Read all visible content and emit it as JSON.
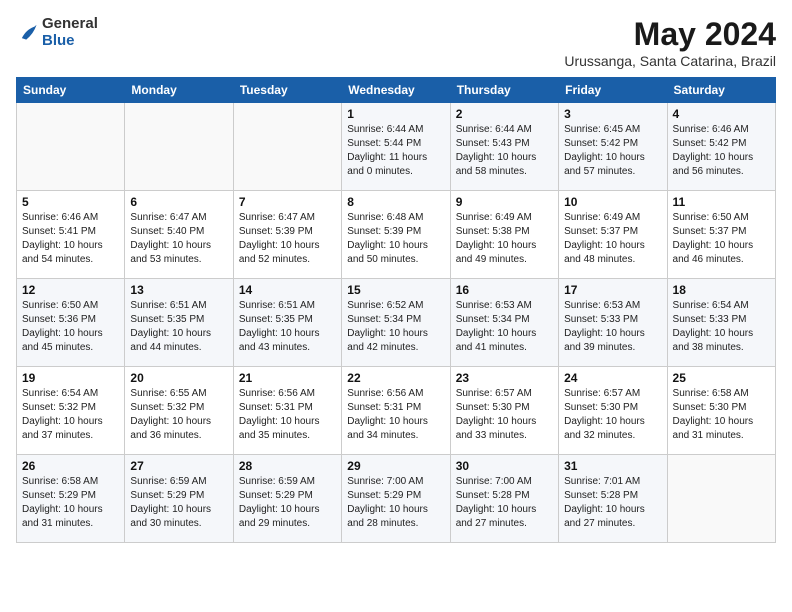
{
  "header": {
    "logo": {
      "general": "General",
      "blue": "Blue"
    },
    "title": "May 2024",
    "location": "Urussanga, Santa Catarina, Brazil"
  },
  "weekdays": [
    "Sunday",
    "Monday",
    "Tuesday",
    "Wednesday",
    "Thursday",
    "Friday",
    "Saturday"
  ],
  "weeks": [
    [
      {
        "day": "",
        "info": ""
      },
      {
        "day": "",
        "info": ""
      },
      {
        "day": "",
        "info": ""
      },
      {
        "day": "1",
        "info": "Sunrise: 6:44 AM\nSunset: 5:44 PM\nDaylight: 11 hours\nand 0 minutes."
      },
      {
        "day": "2",
        "info": "Sunrise: 6:44 AM\nSunset: 5:43 PM\nDaylight: 10 hours\nand 58 minutes."
      },
      {
        "day": "3",
        "info": "Sunrise: 6:45 AM\nSunset: 5:42 PM\nDaylight: 10 hours\nand 57 minutes."
      },
      {
        "day": "4",
        "info": "Sunrise: 6:46 AM\nSunset: 5:42 PM\nDaylight: 10 hours\nand 56 minutes."
      }
    ],
    [
      {
        "day": "5",
        "info": "Sunrise: 6:46 AM\nSunset: 5:41 PM\nDaylight: 10 hours\nand 54 minutes."
      },
      {
        "day": "6",
        "info": "Sunrise: 6:47 AM\nSunset: 5:40 PM\nDaylight: 10 hours\nand 53 minutes."
      },
      {
        "day": "7",
        "info": "Sunrise: 6:47 AM\nSunset: 5:39 PM\nDaylight: 10 hours\nand 52 minutes."
      },
      {
        "day": "8",
        "info": "Sunrise: 6:48 AM\nSunset: 5:39 PM\nDaylight: 10 hours\nand 50 minutes."
      },
      {
        "day": "9",
        "info": "Sunrise: 6:49 AM\nSunset: 5:38 PM\nDaylight: 10 hours\nand 49 minutes."
      },
      {
        "day": "10",
        "info": "Sunrise: 6:49 AM\nSunset: 5:37 PM\nDaylight: 10 hours\nand 48 minutes."
      },
      {
        "day": "11",
        "info": "Sunrise: 6:50 AM\nSunset: 5:37 PM\nDaylight: 10 hours\nand 46 minutes."
      }
    ],
    [
      {
        "day": "12",
        "info": "Sunrise: 6:50 AM\nSunset: 5:36 PM\nDaylight: 10 hours\nand 45 minutes."
      },
      {
        "day": "13",
        "info": "Sunrise: 6:51 AM\nSunset: 5:35 PM\nDaylight: 10 hours\nand 44 minutes."
      },
      {
        "day": "14",
        "info": "Sunrise: 6:51 AM\nSunset: 5:35 PM\nDaylight: 10 hours\nand 43 minutes."
      },
      {
        "day": "15",
        "info": "Sunrise: 6:52 AM\nSunset: 5:34 PM\nDaylight: 10 hours\nand 42 minutes."
      },
      {
        "day": "16",
        "info": "Sunrise: 6:53 AM\nSunset: 5:34 PM\nDaylight: 10 hours\nand 41 minutes."
      },
      {
        "day": "17",
        "info": "Sunrise: 6:53 AM\nSunset: 5:33 PM\nDaylight: 10 hours\nand 39 minutes."
      },
      {
        "day": "18",
        "info": "Sunrise: 6:54 AM\nSunset: 5:33 PM\nDaylight: 10 hours\nand 38 minutes."
      }
    ],
    [
      {
        "day": "19",
        "info": "Sunrise: 6:54 AM\nSunset: 5:32 PM\nDaylight: 10 hours\nand 37 minutes."
      },
      {
        "day": "20",
        "info": "Sunrise: 6:55 AM\nSunset: 5:32 PM\nDaylight: 10 hours\nand 36 minutes."
      },
      {
        "day": "21",
        "info": "Sunrise: 6:56 AM\nSunset: 5:31 PM\nDaylight: 10 hours\nand 35 minutes."
      },
      {
        "day": "22",
        "info": "Sunrise: 6:56 AM\nSunset: 5:31 PM\nDaylight: 10 hours\nand 34 minutes."
      },
      {
        "day": "23",
        "info": "Sunrise: 6:57 AM\nSunset: 5:30 PM\nDaylight: 10 hours\nand 33 minutes."
      },
      {
        "day": "24",
        "info": "Sunrise: 6:57 AM\nSunset: 5:30 PM\nDaylight: 10 hours\nand 32 minutes."
      },
      {
        "day": "25",
        "info": "Sunrise: 6:58 AM\nSunset: 5:30 PM\nDaylight: 10 hours\nand 31 minutes."
      }
    ],
    [
      {
        "day": "26",
        "info": "Sunrise: 6:58 AM\nSunset: 5:29 PM\nDaylight: 10 hours\nand 31 minutes."
      },
      {
        "day": "27",
        "info": "Sunrise: 6:59 AM\nSunset: 5:29 PM\nDaylight: 10 hours\nand 30 minutes."
      },
      {
        "day": "28",
        "info": "Sunrise: 6:59 AM\nSunset: 5:29 PM\nDaylight: 10 hours\nand 29 minutes."
      },
      {
        "day": "29",
        "info": "Sunrise: 7:00 AM\nSunset: 5:29 PM\nDaylight: 10 hours\nand 28 minutes."
      },
      {
        "day": "30",
        "info": "Sunrise: 7:00 AM\nSunset: 5:28 PM\nDaylight: 10 hours\nand 27 minutes."
      },
      {
        "day": "31",
        "info": "Sunrise: 7:01 AM\nSunset: 5:28 PM\nDaylight: 10 hours\nand 27 minutes."
      },
      {
        "day": "",
        "info": ""
      }
    ]
  ]
}
